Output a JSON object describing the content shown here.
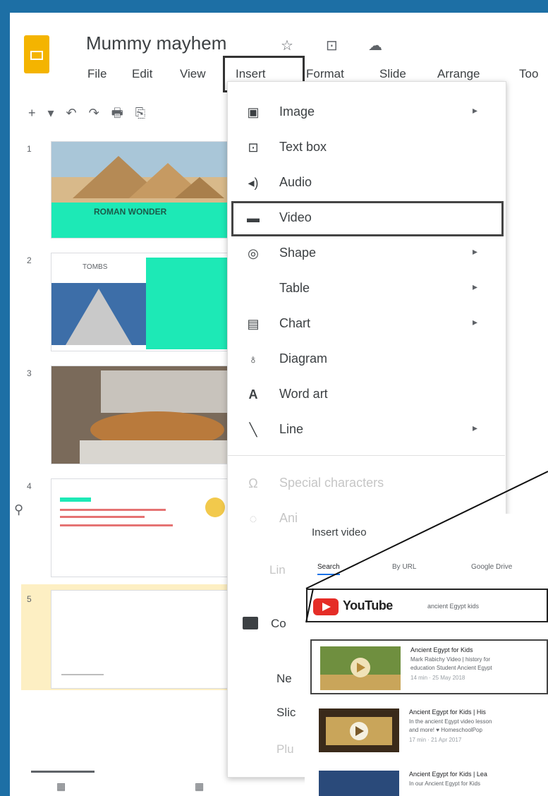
{
  "app": {
    "title": "Mummy mayhem"
  },
  "menu": {
    "items": [
      "File",
      "Edit",
      "View",
      "Insert",
      "Format",
      "Slide",
      "Arrange",
      "Too"
    ]
  },
  "toolbar": {
    "glyphs": "+ ▾ ↶ ↷ 🖶 ⎘"
  },
  "slides": [
    {
      "num": "1",
      "banner": "ROMAN WONDER"
    },
    {
      "num": "2",
      "heading": "TOMBS"
    },
    {
      "num": "3"
    },
    {
      "num": "4"
    },
    {
      "num": "5"
    }
  ],
  "insert_menu": {
    "items": [
      {
        "label": "Image",
        "icon": "image-icon",
        "glyph": "▣",
        "arrow": "▸"
      },
      {
        "label": "Text box",
        "icon": "text-box-icon",
        "glyph": "⊡",
        "arrow": ""
      },
      {
        "label": "Audio",
        "icon": "audio-icon",
        "glyph": "◂)",
        "arrow": ""
      },
      {
        "label": "Video",
        "icon": "video-icon",
        "glyph": "▬",
        "arrow": ""
      },
      {
        "label": "Shape",
        "icon": "shape-icon",
        "glyph": "◎",
        "arrow": "▸"
      },
      {
        "label": "Table",
        "icon": "table-icon",
        "glyph": "",
        "arrow": "▸"
      },
      {
        "label": "Chart",
        "icon": "chart-icon",
        "glyph": "▤",
        "arrow": "▸"
      },
      {
        "label": "Diagram",
        "icon": "diagram-icon",
        "glyph": "♁",
        "arrow": ""
      },
      {
        "label": "Word art",
        "icon": "word-art-icon",
        "glyph": "A",
        "arrow": ""
      },
      {
        "label": "Line",
        "icon": "line-icon",
        "glyph": "╲",
        "arrow": "▸"
      },
      {
        "label": "Special characters",
        "icon": "special-characters-icon",
        "glyph": "Ω",
        "arrow": ""
      },
      {
        "label": "Ani",
        "icon": "animation-icon",
        "glyph": "◌",
        "arrow": ""
      }
    ],
    "partial": [
      "Lin",
      "Co",
      "Ne",
      "Slic",
      "Plu"
    ]
  },
  "insert_video": {
    "title": "Insert video",
    "tabs": [
      "Search",
      "By URL",
      "Google Drive"
    ],
    "provider": "YouTube",
    "query": "ancient Egypt kids",
    "results": [
      {
        "title": "Ancient Egypt for Kids",
        "line1": "Mark Rabichy Video | history for",
        "line2": "education Student Ancient Egypt",
        "meta": "14 min · 25 May 2018"
      },
      {
        "title": "Ancient Egypt for Kids | His",
        "line1": "In the ancient Egypt video lesson",
        "line2": "and more! ♥ HomeschoolPop",
        "meta": "17 min · 21 Apr 2017"
      },
      {
        "title": "Ancient Egypt for Kids | Lea",
        "line1": "In our Ancient Egypt for Kids",
        "line2": "",
        "meta": ""
      }
    ]
  },
  "colors": {
    "accent_teal": "#1de9b6",
    "highlight": "#fdefc3",
    "youtube_red": "#e52d27",
    "chrome_blue": "#1d6fa5"
  }
}
